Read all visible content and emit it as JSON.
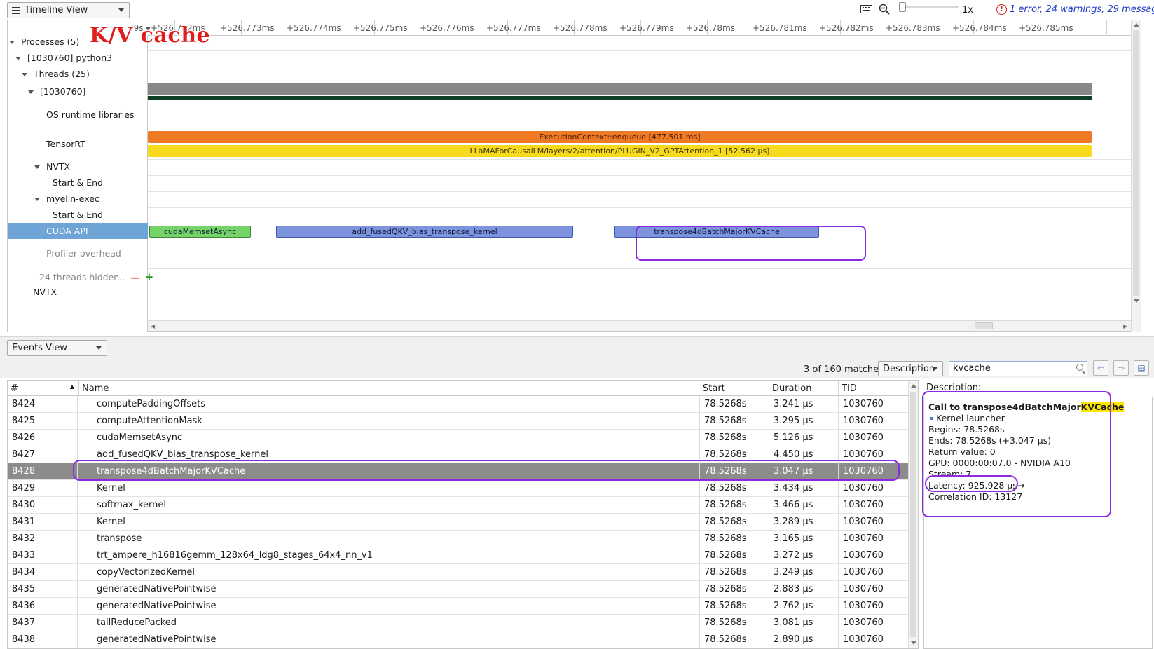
{
  "toolbar": {
    "view_selector": "Timeline View",
    "zoom_label": "1x",
    "error_link": "1 error, 24 warnings, 29 messages"
  },
  "timeline": {
    "ruler_left_label": "79s",
    "ticks": [
      "+526.772ms",
      "+526.773ms",
      "+526.774ms",
      "+526.775ms",
      "+526.776ms",
      "+526.777ms",
      "+526.778ms",
      "+526.779ms",
      "+526.78ms",
      "+526.781ms",
      "+526.782ms",
      "+526.783ms",
      "+526.784ms",
      "+526.785ms"
    ],
    "tree": {
      "processes": "Processes (5)",
      "process": "[1030760] python3",
      "threads": "Threads (25)",
      "thread": "[1030760]",
      "os_runtime": "OS runtime libraries",
      "tensorrt": "TensorRT",
      "nvtx": "NVTX",
      "start_end_1": "Start & End",
      "myelin": "myelin-exec",
      "start_end_2": "Start & End",
      "cuda_api": "CUDA API",
      "profiler_overhead": "Profiler overhead",
      "hidden_threads": "24 threads hidden..",
      "nvtx_bottom": "NVTX"
    },
    "bars": {
      "enqueue": "ExecutionContext::enqueue [477.501 ms]",
      "attention": "LLaMAForCausalLM/layers/2/attention/PLUGIN_V2_GPTAttention_1 [52.562 μs]",
      "memset": "cudaMemsetAsync",
      "fused_qkv": "add_fusedQKV_bias_transpose_kernel",
      "transpose4d": "transpose4dBatchMajorKVCache"
    },
    "colors": {
      "orange": "#ee7a26",
      "yellow": "#f7da1e",
      "green": "#76d36a",
      "blue": "#7d93de",
      "selection": "#8a2be2"
    },
    "annotation": "K/V cache"
  },
  "events": {
    "view_selector": "Events View",
    "matches": "3 of 160 matches",
    "filter_field": "Description",
    "search_value": "kvcache",
    "columns": [
      "#",
      "Name",
      "Start",
      "Duration",
      "TID"
    ],
    "rows": [
      {
        "id": "8424",
        "name": "computePaddingOffsets",
        "start": "78.5268s",
        "duration": "3.241 μs",
        "tid": "1030760"
      },
      {
        "id": "8425",
        "name": "computeAttentionMask",
        "start": "78.5268s",
        "duration": "3.295 μs",
        "tid": "1030760"
      },
      {
        "id": "8426",
        "name": "cudaMemsetAsync",
        "start": "78.5268s",
        "duration": "5.126 μs",
        "tid": "1030760"
      },
      {
        "id": "8427",
        "name": "add_fusedQKV_bias_transpose_kernel",
        "start": "78.5268s",
        "duration": "4.450 μs",
        "tid": "1030760"
      },
      {
        "id": "8428",
        "name": "transpose4dBatchMajorKVCache",
        "start": "78.5268s",
        "duration": "3.047 μs",
        "tid": "1030760"
      },
      {
        "id": "8429",
        "name": "Kernel",
        "start": "78.5268s",
        "duration": "3.434 μs",
        "tid": "1030760"
      },
      {
        "id": "8430",
        "name": "softmax_kernel",
        "start": "78.5268s",
        "duration": "3.466 μs",
        "tid": "1030760"
      },
      {
        "id": "8431",
        "name": "Kernel",
        "start": "78.5268s",
        "duration": "3.289 μs",
        "tid": "1030760"
      },
      {
        "id": "8432",
        "name": "transpose",
        "start": "78.5268s",
        "duration": "3.165 μs",
        "tid": "1030760"
      },
      {
        "id": "8433",
        "name": "trt_ampere_h16816gemm_128x64_ldg8_stages_64x4_nn_v1",
        "start": "78.5268s",
        "duration": "3.272 μs",
        "tid": "1030760"
      },
      {
        "id": "8434",
        "name": "copyVectorizedKernel",
        "start": "78.5268s",
        "duration": "3.249 μs",
        "tid": "1030760"
      },
      {
        "id": "8435",
        "name": "generatedNativePointwise",
        "start": "78.5268s",
        "duration": "2.883 μs",
        "tid": "1030760"
      },
      {
        "id": "8436",
        "name": "generatedNativePointwise",
        "start": "78.5268s",
        "duration": "2.762 μs",
        "tid": "1030760"
      },
      {
        "id": "8437",
        "name": "tailReducePacked",
        "start": "78.5268s",
        "duration": "3.081 μs",
        "tid": "1030760"
      },
      {
        "id": "8438",
        "name": "generatedNativePointwise",
        "start": "78.5268s",
        "duration": "2.890 μs",
        "tid": "1030760"
      }
    ],
    "description": {
      "label": "Description:",
      "title_prefix": "Call to transpose4dBatchMajor",
      "title_highlight": "KVCache",
      "kind": "Kernel launcher",
      "begins": "Begins: 78.5268s",
      "ends": "Ends: 78.5268s (+3.047 μs)",
      "return_value": "Return value: 0",
      "gpu": "GPU: 0000:00:07.0 - NVIDIA A10",
      "stream": "Stream: 7",
      "latency": "Latency: 925.928 μs→",
      "correlation": "Correlation ID: 13127"
    }
  }
}
